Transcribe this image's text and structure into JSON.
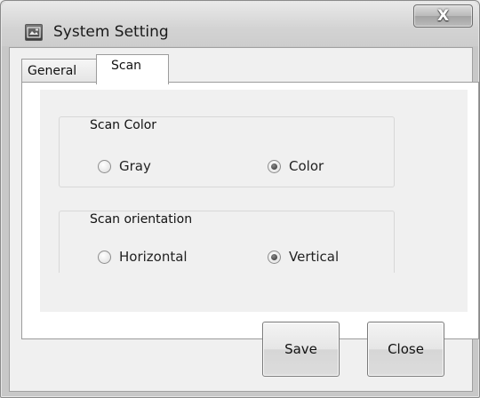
{
  "window": {
    "title": "System Setting",
    "title_icon": "scanner-app-icon",
    "close_label": "X"
  },
  "tabs": [
    {
      "label": "General",
      "active": false
    },
    {
      "label": "Scan",
      "active": true
    }
  ],
  "scan_color": {
    "title": "Scan Color",
    "options": [
      {
        "label": "Gray",
        "selected": false
      },
      {
        "label": "Color",
        "selected": true
      }
    ]
  },
  "scan_orientation": {
    "title": "Scan orientation",
    "options": [
      {
        "label": "Horizontal",
        "selected": false
      },
      {
        "label": "Vertical",
        "selected": true
      }
    ]
  },
  "buttons": {
    "save_label": "Save",
    "close_label": "Close"
  }
}
